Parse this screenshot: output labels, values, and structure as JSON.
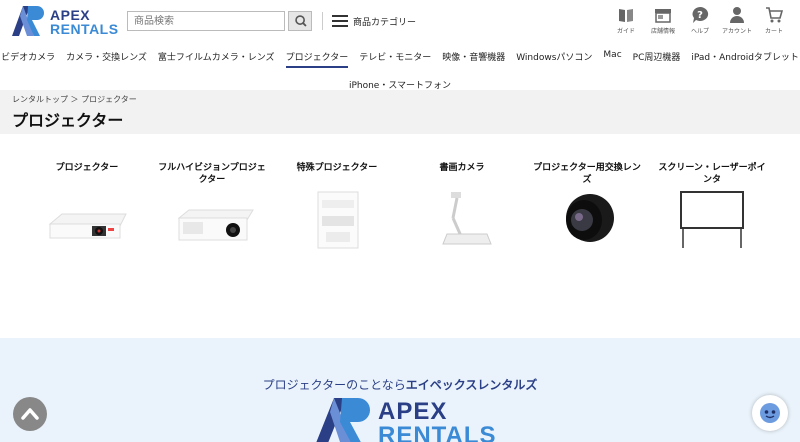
{
  "brand": {
    "line1": "APEX",
    "line2": "RENTALS",
    "primary": "#2b3f86",
    "secondary": "#3a8ad6"
  },
  "search": {
    "placeholder": "商品検索"
  },
  "category_menu": {
    "label": "商品カテゴリー"
  },
  "header_icons": [
    {
      "icon": "guide-icon",
      "label": "ガイド"
    },
    {
      "icon": "store-icon",
      "label": "店舗情報"
    },
    {
      "icon": "help-icon",
      "label": "ヘルプ"
    },
    {
      "icon": "account-icon",
      "label": "アカウント"
    },
    {
      "icon": "cart-icon",
      "label": "カート"
    }
  ],
  "nav": {
    "row1": [
      "ビデオカメラ",
      "カメラ・交換レンズ",
      "富士フイルムカメラ・レンズ",
      "プロジェクター",
      "テレビ・モニター",
      "映像・音響機器",
      "Windowsパソコン",
      "Mac",
      "PC周辺機器",
      "iPad・Androidタブレット"
    ],
    "row2": [
      "iPhone・スマートフォン"
    ],
    "active": "プロジェクター"
  },
  "breadcrumb": "レンタルトップ ＞ プロジェクター",
  "page_title": "プロジェクター",
  "categories": [
    {
      "name": "プロジェクター",
      "icon": "projector-image"
    },
    {
      "name": "フルハイビジョンプロジェクター",
      "icon": "fullhd-projector-image"
    },
    {
      "name": "特殊プロジェクター",
      "icon": "special-projector-image"
    },
    {
      "name": "書画カメラ",
      "icon": "document-camera-image"
    },
    {
      "name": "プロジェクター用交換レンズ",
      "icon": "projector-lens-image"
    },
    {
      "name": "スクリーン・レーザーポインタ",
      "icon": "screen-image"
    }
  ],
  "footer": {
    "tagline_prefix": "プロジェクターのことなら",
    "tagline_brand": "エイペックスレンタルズ",
    "logo_line1": "APEX",
    "logo_line2": "RENTALS"
  }
}
